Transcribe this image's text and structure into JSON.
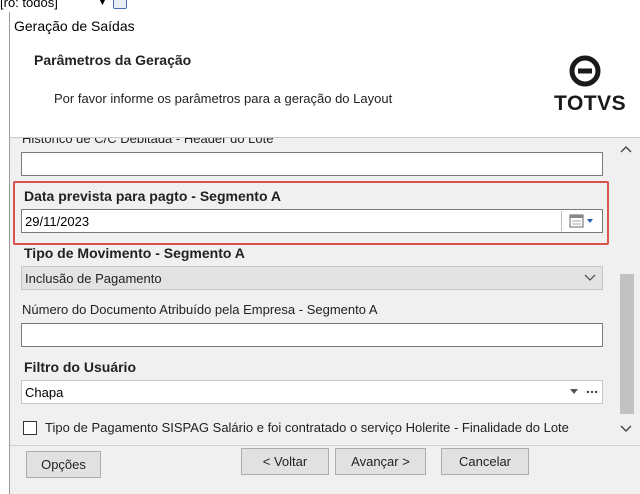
{
  "background": {
    "filter_text": "[ro: todos]"
  },
  "window": {
    "title": "Geração de Saídas"
  },
  "header": {
    "title": "Parâmetros da Geração",
    "subtitle": "Por favor informe os parâmetros para a geração do Layout",
    "logo_text": "TOTVS"
  },
  "form": {
    "cut_label": "Histórico de C/C Debitada - Header do Lote",
    "cut_value": "",
    "data_prevista": {
      "label": "Data prevista para pagto - Segmento A",
      "value": "29/11/2023"
    },
    "tipo_movimento": {
      "label": "Tipo de Movimento - Segmento A",
      "value": "Inclusão de Pagamento"
    },
    "numero_documento": {
      "label": "Número do Documento Atribuído pela Empresa - Segmento A",
      "value": ""
    },
    "filtro_usuario": {
      "label": "Filtro do Usuário",
      "value": "Chapa"
    },
    "tipo_pagamento_checkbox": {
      "label": "Tipo de Pagamento SISPAG Salário e foi contratado o serviço Holerite - Finalidade do Lote",
      "checked": false
    }
  },
  "footer": {
    "opcoes": "Opções",
    "voltar": "< Voltar",
    "avancar": "Avançar >",
    "cancelar": "Cancelar"
  },
  "colors": {
    "highlight": "#d9534f",
    "window_bg": "#f0f0f0"
  },
  "icons": [
    "calendar-icon",
    "chevron-down-icon",
    "scroll-up-icon",
    "scroll-down-icon",
    "ellipsis-icon",
    "totvs-logo-icon"
  ]
}
